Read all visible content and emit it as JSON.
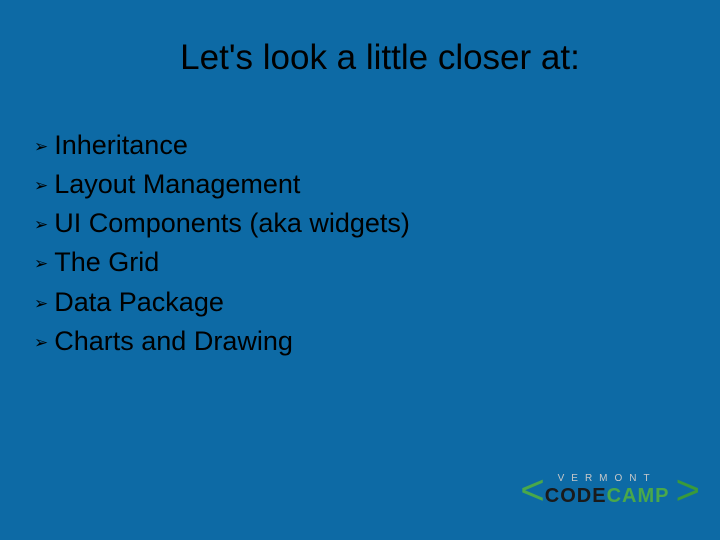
{
  "title": "Let's look a little closer at:",
  "bullets": [
    "Inheritance",
    "Layout Management",
    "UI Components (aka widgets)",
    "The Grid",
    "Data Package",
    "Charts and Drawing"
  ],
  "logo": {
    "top": "VERMONT",
    "code": "CODE",
    "camp": "CAMP"
  }
}
